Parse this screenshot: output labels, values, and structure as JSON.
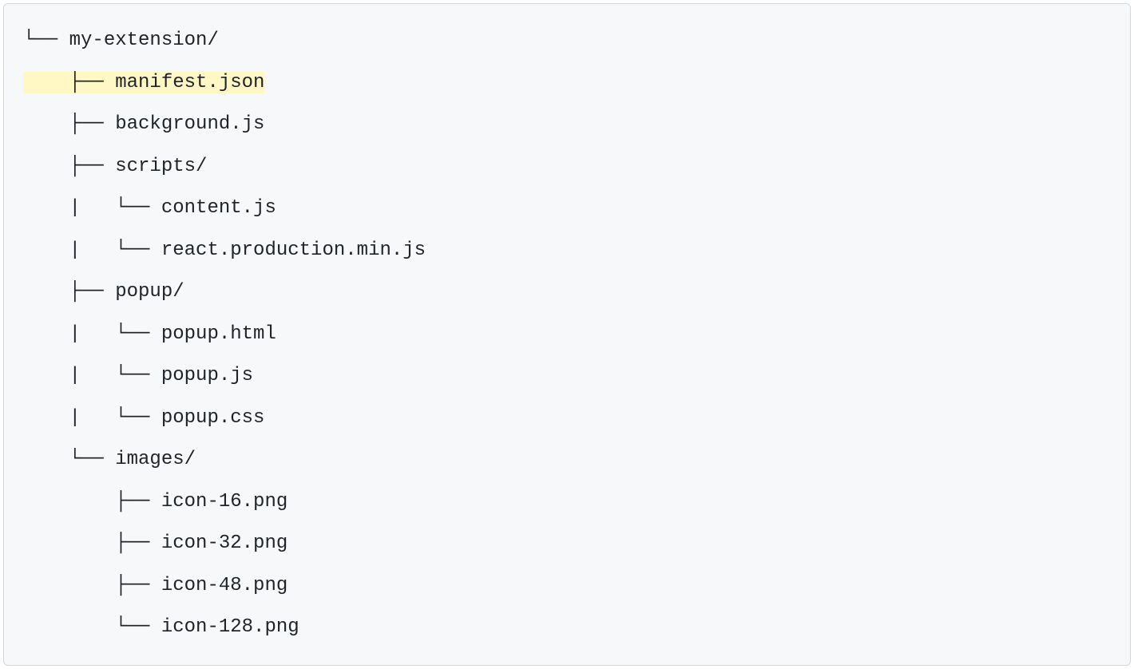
{
  "tree": {
    "lines": [
      {
        "text": "└── my-extension/",
        "highlighted": false
      },
      {
        "text": "    ├── manifest.json",
        "highlighted": true
      },
      {
        "text": "    ├── background.js",
        "highlighted": false
      },
      {
        "text": "    ├── scripts/",
        "highlighted": false
      },
      {
        "text": "    |   └── content.js",
        "highlighted": false
      },
      {
        "text": "    |   └── react.production.min.js",
        "highlighted": false
      },
      {
        "text": "    ├── popup/",
        "highlighted": false
      },
      {
        "text": "    |   └── popup.html",
        "highlighted": false
      },
      {
        "text": "    |   └── popup.js",
        "highlighted": false
      },
      {
        "text": "    |   └── popup.css",
        "highlighted": false
      },
      {
        "text": "    └── images/",
        "highlighted": false
      },
      {
        "text": "        ├── icon-16.png",
        "highlighted": false
      },
      {
        "text": "        ├── icon-32.png",
        "highlighted": false
      },
      {
        "text": "        ├── icon-48.png",
        "highlighted": false
      },
      {
        "text": "        └── icon-128.png",
        "highlighted": false
      }
    ]
  }
}
